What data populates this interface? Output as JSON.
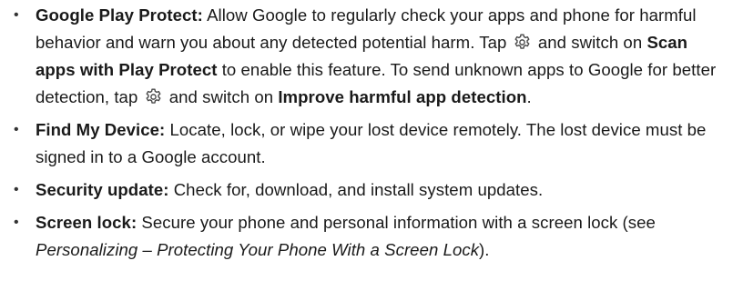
{
  "items": [
    {
      "term": "Google Play Protect:",
      "text_1": " Allow Google to regularly check your apps and phone for harmful behavior and warn you about any detected potential harm. Tap ",
      "icon_1": "gear-icon",
      "text_2": " and switch on ",
      "bold_1": "Scan apps with Play Protect",
      "text_3": " to enable this feature. To send unknown apps to Google for better detection, tap ",
      "icon_2": "gear-icon",
      "text_4": " and switch on ",
      "bold_2": "Improve harmful app detection",
      "text_5": "."
    },
    {
      "term": "Find My Device:",
      "text_1": " Locate, lock, or wipe your lost device remotely. The lost device must be signed in to a Google account."
    },
    {
      "term": "Security update:",
      "text_1": " Check for, download, and install system updates."
    },
    {
      "term": "Screen lock:",
      "text_1": " Secure your phone and personal information with a screen lock (see ",
      "italic_1": "Personalizing – Protecting Your Phone With a Screen Lock",
      "text_2": ")."
    }
  ],
  "bullet_char": "•",
  "colors": {
    "text": "#1a1a1a",
    "icon": "#4a4a4a"
  }
}
